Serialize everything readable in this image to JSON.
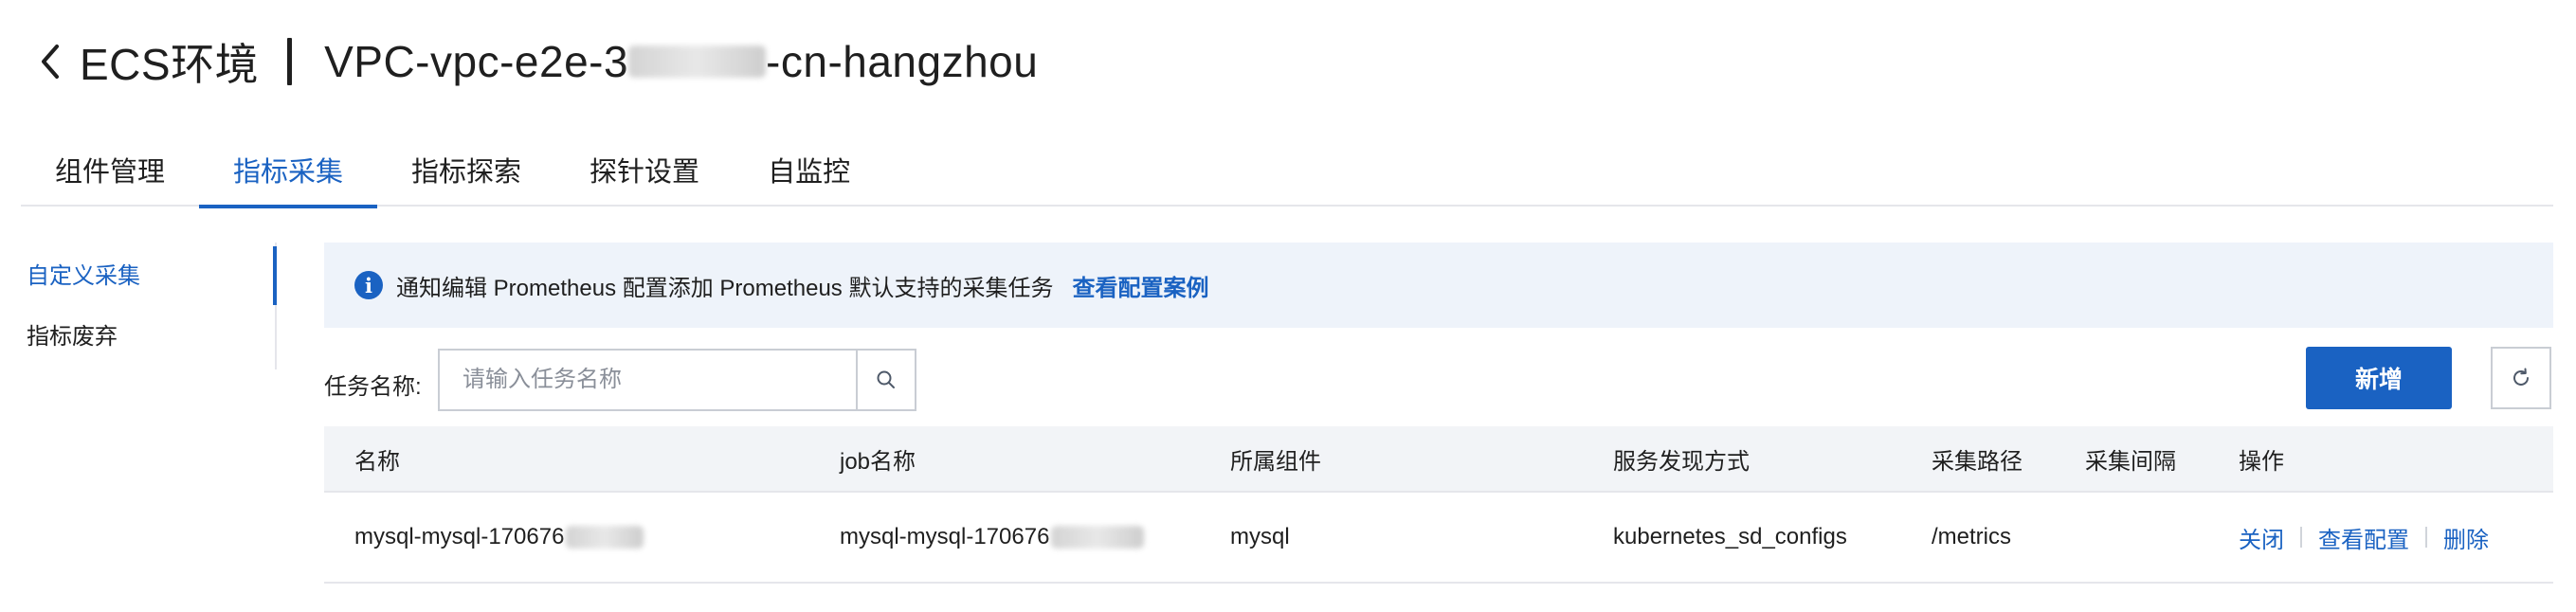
{
  "header": {
    "back_icon": "chevron-left-icon",
    "env_title": "ECS环境",
    "vpc_prefix": "VPC-vpc-e2e-3",
    "vpc_suffix": "-cn-hangzhou"
  },
  "tabs": [
    {
      "label": "组件管理",
      "active": false
    },
    {
      "label": "指标采集",
      "active": true
    },
    {
      "label": "指标探索",
      "active": false
    },
    {
      "label": "探针设置",
      "active": false
    },
    {
      "label": "自监控",
      "active": false
    }
  ],
  "sidenav": {
    "items": [
      {
        "label": "自定义采集",
        "active": true
      },
      {
        "label": "指标废弃",
        "active": false
      }
    ]
  },
  "banner": {
    "icon": "info-icon",
    "text": "通知编辑 Prometheus 配置添加 Prometheus 默认支持的采集任务",
    "link": "查看配置案例"
  },
  "search": {
    "label": "任务名称:",
    "placeholder": "请输入任务名称",
    "icon": "search-icon"
  },
  "toolbar": {
    "add_label": "新增",
    "refresh_icon": "refresh-icon"
  },
  "table": {
    "columns": [
      "名称",
      "job名称",
      "所属组件",
      "服务发现方式",
      "采集路径",
      "采集间隔",
      "操作"
    ],
    "rows": [
      {
        "name": "mysql-mysql-170676",
        "job_name": "mysql-mysql-170676",
        "component": "mysql",
        "discovery": "kubernetes_sd_configs",
        "path": "/metrics",
        "interval": "",
        "actions": [
          "关闭",
          "查看配置",
          "删除"
        ]
      }
    ]
  },
  "colors": {
    "accent": "#1a62c2",
    "banner_bg": "#eef3fa",
    "table_header_bg": "#f2f4f7"
  }
}
